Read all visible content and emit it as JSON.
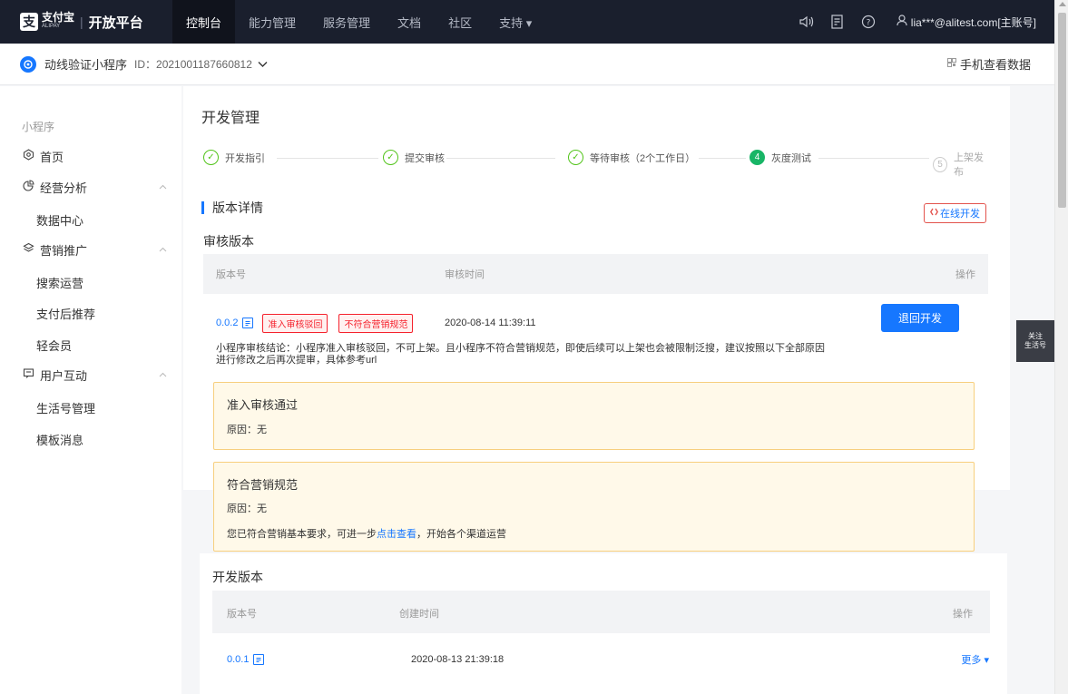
{
  "topnav": {
    "logo_brand": "支付宝",
    "logo_brand_en": "ALIPAY",
    "logo_separator": "|",
    "platform": "开放平台",
    "items": [
      {
        "label": "控制台"
      },
      {
        "label": "能力管理"
      },
      {
        "label": "服务管理"
      },
      {
        "label": "文档"
      },
      {
        "label": "社区"
      },
      {
        "label": "支持 ▾"
      }
    ],
    "account": "lia***@alitest.com[主账号]"
  },
  "subheader": {
    "app_name": "动线验证小程序",
    "app_id": "ID：2021001187660812",
    "mobile_data": "手机查看数据"
  },
  "sidebar": {
    "title": "小程序",
    "items": [
      {
        "label": "首页"
      },
      {
        "label": "经营分析"
      },
      {
        "label": "数据中心"
      },
      {
        "label": "营销推广"
      },
      {
        "label": "搜索运营"
      },
      {
        "label": "支付后推荐"
      },
      {
        "label": "轻会员"
      },
      {
        "label": "用户互动"
      },
      {
        "label": "生活号管理"
      },
      {
        "label": "模板消息"
      }
    ]
  },
  "main": {
    "page_title": "开发管理",
    "steps": [
      {
        "label": "开发指引",
        "mark": "✓"
      },
      {
        "label": "提交审核",
        "mark": "✓"
      },
      {
        "label": "等待审核（2个工作日）",
        "mark": "✓"
      },
      {
        "label": "灰度测试",
        "mark": "4"
      },
      {
        "label": "上架发布",
        "mark": "5"
      }
    ],
    "section_title": "版本详情",
    "online_dev": "在线开发",
    "review": {
      "title": "审核版本",
      "col_version": "版本号",
      "col_time": "审核时间",
      "col_op": "操作",
      "version": "0.0.2",
      "tags": [
        "准入审核驳回",
        "不符合营销规范"
      ],
      "time": "2020-08-14 11:39:11",
      "return_btn": "退回开发",
      "conclusion_line1": "小程序审核结论：小程序准入审核驳回，不可上架。且小程序不符合营销规范，即使后续可以上架也会被限制泛搜，建议按照以下全部原因",
      "conclusion_line2": "进行修改之后再次提审，具体参考url",
      "card1_title": "准入审核通过",
      "card1_reason": "原因：无",
      "card2_title": "符合营销规范",
      "card2_reason": "原因：无",
      "card2_note_prefix": "您已符合营销基本要求，可进一步",
      "card2_note_link": "点击查看",
      "card2_note_suffix": "，开始各个渠道运营"
    },
    "dev": {
      "title": "开发版本",
      "col_version": "版本号",
      "col_time": "创建时间",
      "col_op": "操作",
      "version": "0.0.1",
      "time": "2020-08-13 21:39:18",
      "more": "更多 ▾"
    }
  },
  "follow": {
    "line1": "关注",
    "line2": "生活号"
  },
  "colors": {
    "nav_bg": "#1a1f2d",
    "primary": "#1677ff",
    "success": "#18b566",
    "danger": "#f5222d",
    "warn_bg": "#fff9e9"
  }
}
